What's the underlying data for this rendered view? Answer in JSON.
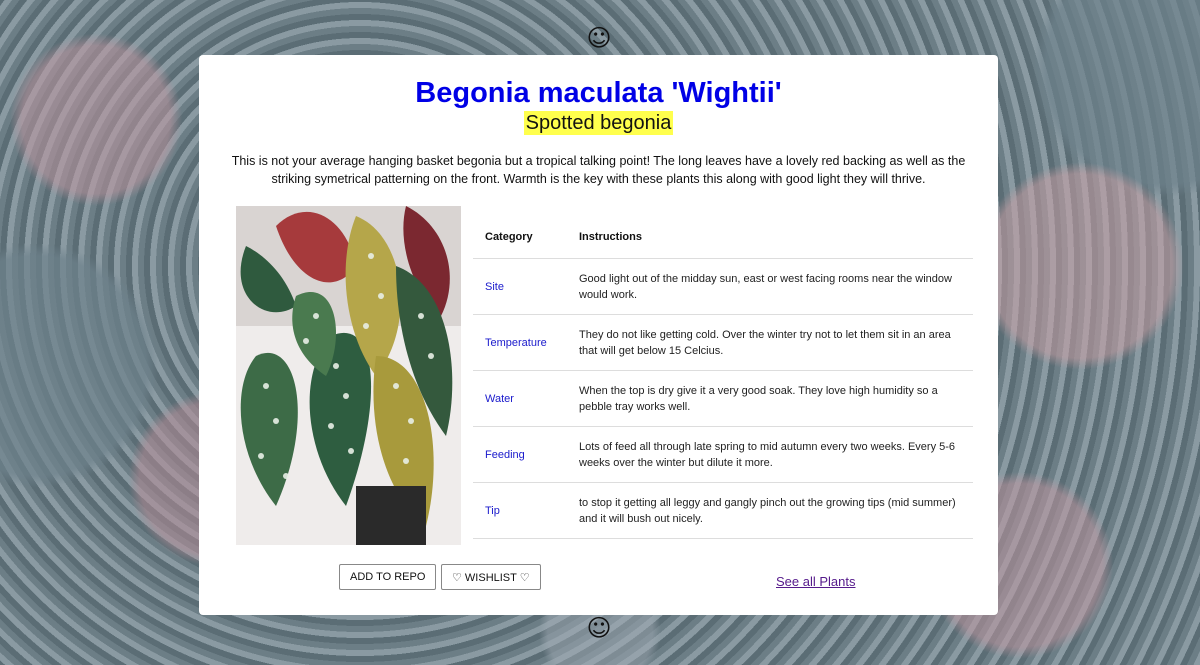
{
  "header": {
    "smiley": "☺"
  },
  "footer": {
    "smiley": "☺"
  },
  "plant": {
    "title": "Begonia maculata 'Wightii'",
    "common_name": "Spotted begonia",
    "description": "This is not your average hanging basket begonia but a tropical talking point! The long leaves have a lovely red backing as well as the striking symetrical patterning on the front. Warmth is the key with these plants this along with good light they will thrive."
  },
  "care_table": {
    "headers": [
      "Category",
      "Instructions"
    ],
    "rows": [
      {
        "category": "Site",
        "instructions": "Good light out of the midday sun, east or west facing rooms near the window would work."
      },
      {
        "category": "Temperature",
        "instructions": "They do not like getting cold. Over the winter try not to let them sit in an area that will get below 15 Celcius."
      },
      {
        "category": "Water",
        "instructions": "When the top is dry give it a very good soak. They love high humidity so a pebble tray works well."
      },
      {
        "category": "Feeding",
        "instructions": "Lots of feed all through late spring to mid autumn every two weeks. Every 5-6 weeks over the winter but dilute it more."
      },
      {
        "category": "Tip",
        "instructions": "to stop it getting all leggy and gangly pinch out the growing tips (mid summer) and it will bush out nicely."
      }
    ]
  },
  "actions": {
    "add_to_repo": "ADD TO REPO",
    "wishlist": "♡ WISHLIST ♡",
    "see_all": "See all Plants"
  },
  "colors": {
    "title": "#0000e6",
    "highlight": "#ffff4d",
    "category_link": "#1a1acc",
    "visited_link": "#551a8b"
  }
}
